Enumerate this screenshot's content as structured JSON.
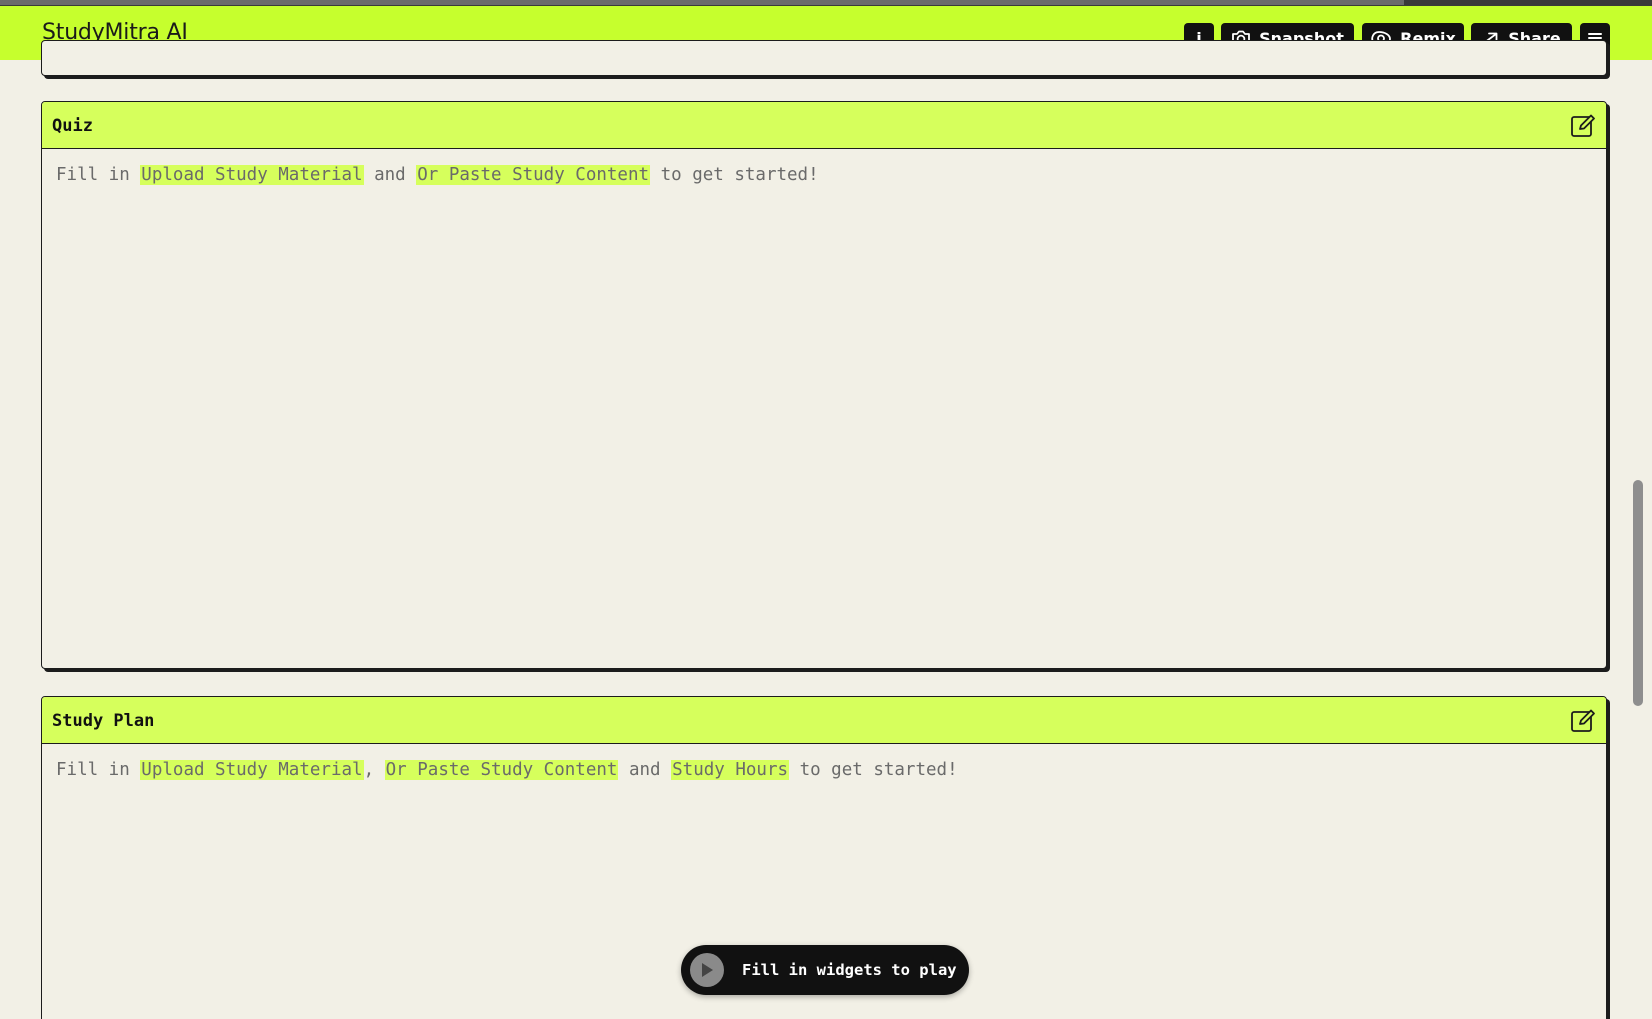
{
  "app": {
    "title": "StudyMitra AI"
  },
  "toolbar": {
    "info_label": "i",
    "snapshot_label": "Snapshot",
    "remix_label": "Remix",
    "share_label": "Share"
  },
  "cards": [
    {
      "title": "Quiz",
      "prompt": {
        "prefix": "Fill in ",
        "fields": [
          "Upload Study Material",
          "Or Paste Study Content"
        ],
        "sep1": " and ",
        "suffix": " to get started!"
      }
    },
    {
      "title": "Study Plan",
      "prompt": {
        "prefix": "Fill in ",
        "fields": [
          "Upload Study Material",
          "Or Paste Study Content",
          "Study Hours"
        ],
        "sep1": ", ",
        "sep2": " and ",
        "suffix": " to get started!"
      }
    }
  ],
  "player": {
    "label": "Fill in widgets to play"
  },
  "colors": {
    "accent": "#c6ff2d",
    "card_header": "#d6ff5c",
    "background": "#f2f0e6",
    "dark": "#111111"
  },
  "icons": {
    "snapshot": "camera-icon",
    "remix": "remix-icon",
    "share": "share-arrow-icon",
    "menu": "menu-icon",
    "edit": "edit-icon",
    "play": "play-icon"
  }
}
